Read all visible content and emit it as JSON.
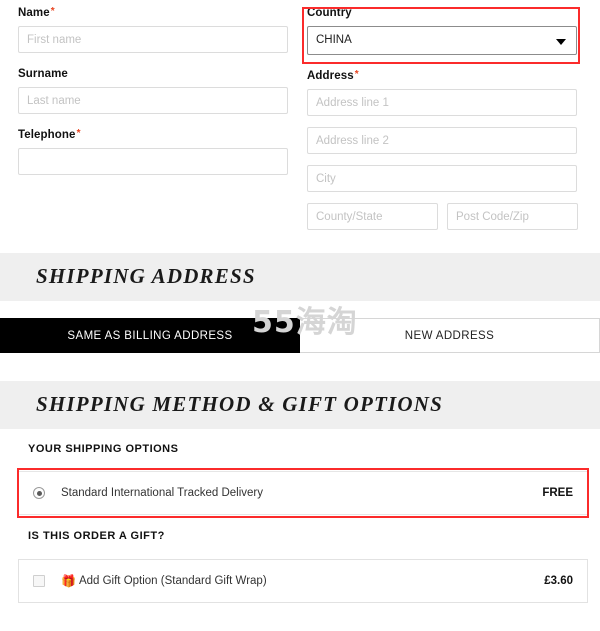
{
  "billing": {
    "left_fields": [
      {
        "label": "Name",
        "required": true,
        "placeholder": "First name",
        "value": "",
        "name": "first-name"
      },
      {
        "label": "Surname",
        "required": false,
        "placeholder": "Last name",
        "value": "",
        "name": "last-name"
      },
      {
        "label": "Telephone",
        "required": true,
        "placeholder": "",
        "value": "",
        "name": "telephone"
      }
    ],
    "country": {
      "label": "Country",
      "required": false,
      "selected": "CHINA",
      "caret_icon": "chevron-down-icon"
    },
    "address": {
      "label": "Address",
      "required": true,
      "line1_placeholder": "Address line 1",
      "line1_value": "",
      "line2_placeholder": "Address line 2",
      "line2_value": "",
      "city_placeholder": "City",
      "city_value": "",
      "county_placeholder": "County/State",
      "county_value": "",
      "postcode_placeholder": "Post Code/Zip",
      "postcode_value": ""
    }
  },
  "shipping_address": {
    "heading": "SHIPPING ADDRESS",
    "tabs": [
      {
        "label": "SAME AS BILLING ADDRESS",
        "active": true
      },
      {
        "label": "NEW ADDRESS",
        "active": false
      }
    ]
  },
  "shipping_method": {
    "heading": "SHIPPING METHOD & GIFT OPTIONS",
    "options_label": "YOUR SHIPPING OPTIONS",
    "option": {
      "label": "Standard International Tracked Delivery",
      "price": "FREE",
      "selected": true
    },
    "gift_label": "IS THIS ORDER A GIFT?",
    "gift": {
      "icon": "gift-icon",
      "label": "Add Gift Option (Standard Gift Wrap)",
      "price": "£3.60",
      "checked": false
    }
  },
  "watermark": {
    "text": "55海淘"
  },
  "colors": {
    "accent_red": "#fb2b2b",
    "required_star": "#e8431f",
    "band_gray": "#efefef",
    "tab_active_bg": "#000000"
  }
}
